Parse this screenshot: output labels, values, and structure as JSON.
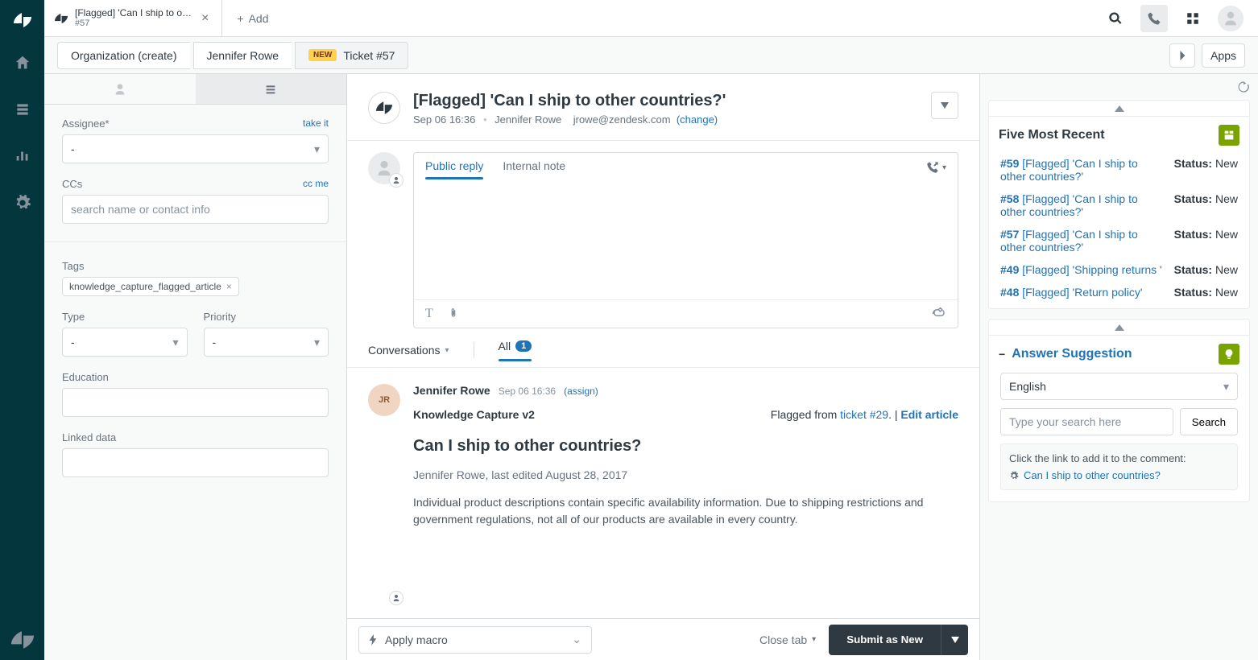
{
  "tabs": {
    "active": {
      "title": "[Flagged] 'Can I ship to o…",
      "sub": "#57"
    },
    "add_label": "Add"
  },
  "context": {
    "org": "Organization (create)",
    "user": "Jennifer Rowe",
    "badge": "NEW",
    "ticket_label": "Ticket #57",
    "apps_btn": "Apps"
  },
  "props": {
    "assignee_label": "Assignee*",
    "take_it": "take it",
    "assignee_value": "-",
    "ccs_label": "CCs",
    "cc_me": "cc me",
    "ccs_placeholder": "search name or contact info",
    "tags_label": "Tags",
    "tag_value": "knowledge_capture_flagged_article",
    "type_label": "Type",
    "type_value": "-",
    "priority_label": "Priority",
    "priority_value": "-",
    "education_label": "Education",
    "linked_label": "Linked data"
  },
  "ticket": {
    "title": "[Flagged] 'Can I ship to other countries?'",
    "date": "Sep 06 16:36",
    "requester": "Jennifer Rowe",
    "email": "jrowe@zendesk.com",
    "change": "(change)"
  },
  "editor": {
    "public_reply": "Public reply",
    "internal_note": "Internal note"
  },
  "conversations": {
    "label": "Conversations",
    "all": "All",
    "count": "1"
  },
  "event": {
    "author": "Jennifer Rowe",
    "time": "Sep 06 16:36",
    "assign": "(assign)",
    "kc_title": "Knowledge Capture v2",
    "flagged_from": "Flagged from ",
    "ticket_ref": "ticket #29",
    "sep": ". | ",
    "edit_article": "Edit article",
    "article_title": "Can I ship to other countries?",
    "article_meta": "Jennifer Rowe, last edited August 28, 2017",
    "article_body": "Individual product descriptions contain specific availability information. Due to shipping restrictions and government regulations, not all of our products are available in every country."
  },
  "footer": {
    "macro": "Apply macro",
    "close_tab": "Close tab",
    "submit": "Submit as New"
  },
  "apps": {
    "recent_title": "Five Most Recent",
    "items": [
      {
        "id": "#59",
        "title": "[Flagged] 'Can I ship to other countries?'",
        "status_label": "Status:",
        "status": "New"
      },
      {
        "id": "#58",
        "title": "[Flagged] 'Can I ship to other countries?'",
        "status_label": "Status:",
        "status": "New"
      },
      {
        "id": "#57",
        "title": "[Flagged] 'Can I ship to other countries?'",
        "status_label": "Status:",
        "status": "New"
      },
      {
        "id": "#49",
        "title": "[Flagged] 'Shipping returns '",
        "status_label": "Status:",
        "status": "New"
      },
      {
        "id": "#48",
        "title": "[Flagged] 'Return policy'",
        "status_label": "Status:",
        "status": "New"
      }
    ],
    "answer_title": "Answer Suggestion",
    "language": "English",
    "search_placeholder": "Type your search here",
    "search_btn": "Search",
    "hint_text": "Click the link to add it to the comment:",
    "hint_link": "Can I ship to other countries?"
  }
}
